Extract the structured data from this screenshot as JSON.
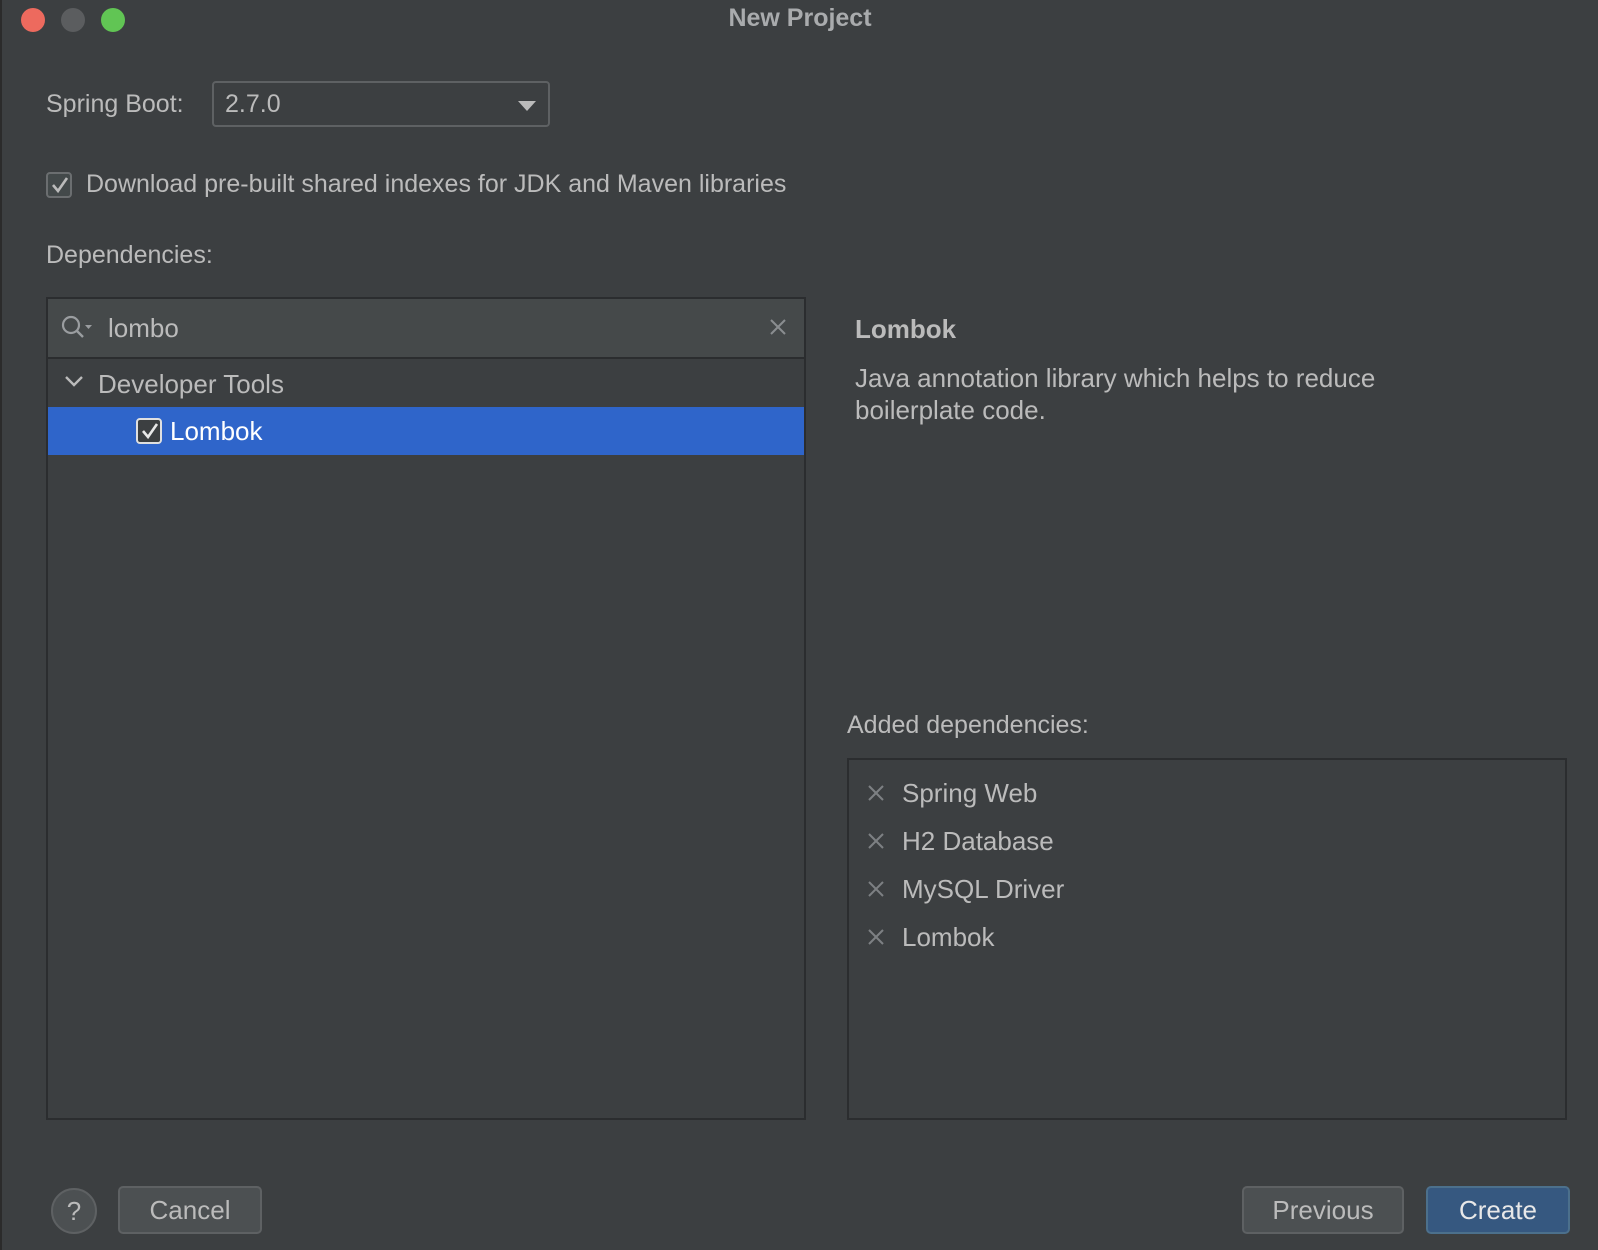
{
  "window": {
    "title": "New Project"
  },
  "spring_boot": {
    "label": "Spring Boot:",
    "selected_version": "2.7.0"
  },
  "shared_indexes": {
    "checked": true,
    "label": "Download pre-built shared indexes for JDK and Maven libraries"
  },
  "dependencies": {
    "label": "Dependencies:",
    "search": {
      "value": "lombo"
    },
    "tree": {
      "group": {
        "label": "Developer Tools",
        "expanded": true
      },
      "items": [
        {
          "label": "Lombok",
          "checked": true,
          "selected": true
        }
      ]
    }
  },
  "description": {
    "title": "Lombok",
    "text": "Java annotation library which helps to reduce boilerplate code."
  },
  "added": {
    "label": "Added dependencies:",
    "items": [
      {
        "label": "Spring Web"
      },
      {
        "label": "H2 Database"
      },
      {
        "label": "MySQL Driver"
      },
      {
        "label": "Lombok"
      }
    ]
  },
  "footer": {
    "help_label": "?",
    "cancel_label": "Cancel",
    "previous_label": "Previous",
    "create_label": "Create"
  },
  "colors": {
    "background": "#3c3f41",
    "selection": "#2f65ca",
    "primary_button": "#365880",
    "close": "#ed6a5e",
    "zoom": "#61c554"
  }
}
